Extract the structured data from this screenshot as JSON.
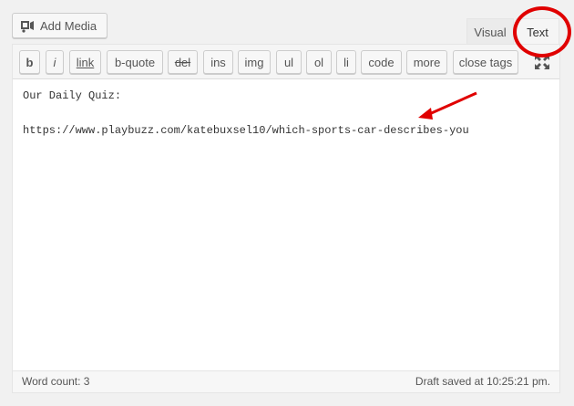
{
  "toolbar_top": {
    "add_media_label": "Add Media",
    "add_media_icon": "media-icon"
  },
  "tabs": {
    "visual": "Visual",
    "text": "Text",
    "active": "Text"
  },
  "quicktags": [
    "b",
    "i",
    "link",
    "b-quote",
    "del",
    "ins",
    "img",
    "ul",
    "ol",
    "li",
    "code",
    "more",
    "close tags"
  ],
  "editor": {
    "line1": "Our Daily Quiz:",
    "line2": "https://www.playbuzz.com/katebuxsel10/which-sports-car-describes-you"
  },
  "status": {
    "word_count": "Word count: 3",
    "draft_saved": "Draft saved at 10:25:21 pm."
  },
  "colors": {
    "annotation": "#e00000"
  }
}
